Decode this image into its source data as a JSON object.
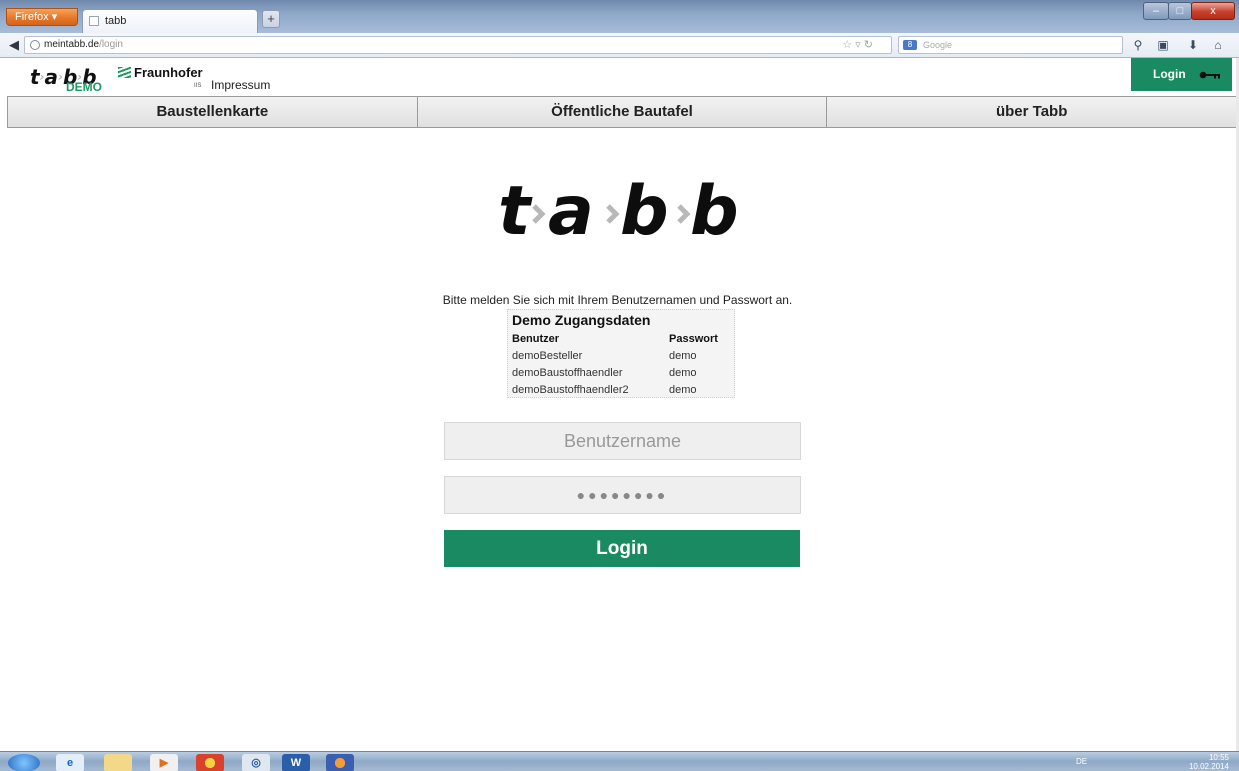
{
  "browser": {
    "app_button": "Firefox ▾",
    "tab_title": "tabb",
    "new_tab": "+",
    "window_min": "–",
    "window_max": "□",
    "window_close": "x",
    "url_host": "meintabb.de",
    "url_path": "/login",
    "search_placeholder": "Google",
    "search_engine_label": "8"
  },
  "header": {
    "logo_text_t": "t",
    "logo_text_a": "a",
    "logo_text_b1": "b",
    "logo_text_b2": "b",
    "demo_badge": "DEMO",
    "fraunhofer": "Fraunhofer",
    "fraunhofer_sub": "IIS",
    "impressum": "Impressum",
    "login_button": "Login"
  },
  "main_nav": {
    "items": [
      {
        "label": "Baustellenkarte"
      },
      {
        "label": "Öffentliche Bautafel"
      },
      {
        "label": "über Tabb"
      }
    ]
  },
  "login": {
    "instruction": "Bitte melden Sie sich mit Ihrem Benutzernamen und Passwort an.",
    "demo_title": "Demo Zugangsdaten",
    "col_user": "Benutzer",
    "col_password": "Passwort",
    "rows": [
      {
        "user": "demoBesteller",
        "password": "demo"
      },
      {
        "user": "demoBaustoffhaendler",
        "password": "demo"
      },
      {
        "user": "demoBaustoffhaendler2",
        "password": "demo"
      }
    ],
    "username_placeholder": "Benutzername",
    "password_value": "●●●●●●●●",
    "submit_label": "Login"
  },
  "taskbar": {
    "lang": "DE",
    "time": "10:55",
    "date": "10.02.2014"
  },
  "colors": {
    "accent_green": "#1a8a62",
    "demo_green": "#1a9a62"
  }
}
